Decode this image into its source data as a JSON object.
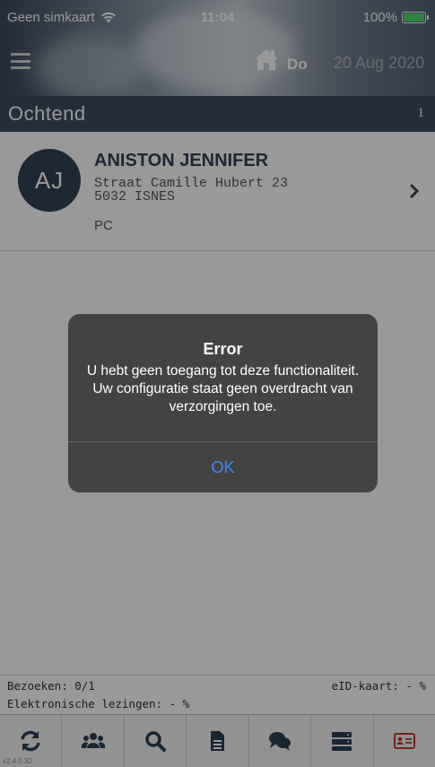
{
  "status_bar": {
    "carrier": "Geen simkaart",
    "time": "11:04",
    "battery": "100%"
  },
  "header": {
    "day": "Do",
    "date": "20 Aug 2020"
  },
  "section": {
    "title": "Ochtend",
    "count": "1"
  },
  "patient": {
    "initials": "AJ",
    "name": "ANISTON JENNIFER",
    "address_line1": "Straat Camille Hubert 23",
    "address_line2": "5032 ISNES",
    "type": "PC"
  },
  "stats": {
    "visits": "Bezoeken: 0/1",
    "electronic_readings": "Elektronische lezingen: - %",
    "eid_card": "eID-kaart: - %"
  },
  "tabbar": {
    "version": "v2.4.0.32",
    "tabs": [
      {
        "icon": "sync-icon",
        "color": "#2c3e58"
      },
      {
        "icon": "users-icon",
        "color": "#2c3e58"
      },
      {
        "icon": "search-icon",
        "color": "#2c3e58"
      },
      {
        "icon": "document-icon",
        "color": "#2c3e58"
      },
      {
        "icon": "chat-icon",
        "color": "#2c3e58"
      },
      {
        "icon": "server-icon",
        "color": "#2c3e58"
      },
      {
        "icon": "id-card-icon",
        "color": "#c0392b"
      }
    ]
  },
  "alert": {
    "title": "Error",
    "message": "U hebt geen toegang tot deze functionaliteit. Uw configuratie staat geen overdracht van verzorgingen toe.",
    "ok_label": "OK"
  },
  "colors": {
    "primary": "#334157",
    "section_bg": "#3c4d63",
    "ok_blue": "#3b8bff",
    "battery_green": "#4cd964"
  }
}
